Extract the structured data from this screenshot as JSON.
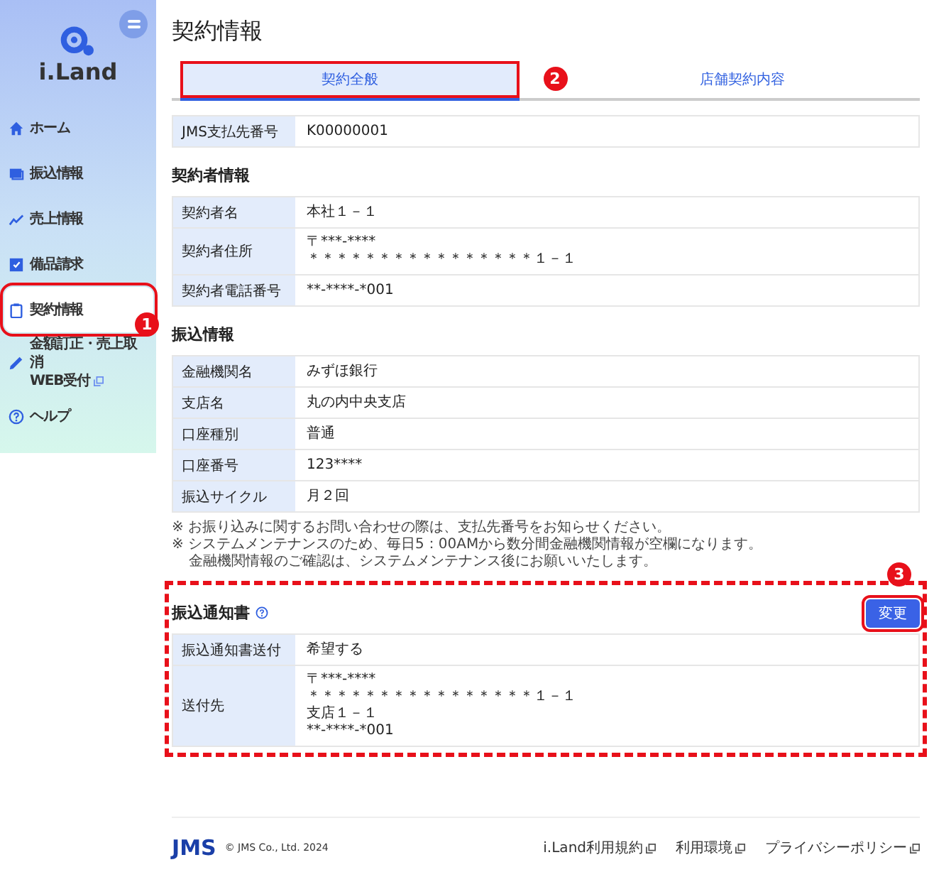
{
  "sidebar": {
    "logo": "i.Land",
    "items": [
      {
        "label": "ホーム",
        "selected": false,
        "highlighted": false
      },
      {
        "label": "振込情報",
        "selected": false,
        "highlighted": false
      },
      {
        "label": "売上情報",
        "selected": false,
        "highlighted": false
      },
      {
        "label": "備品請求",
        "selected": false,
        "highlighted": false
      },
      {
        "label": "契約情報",
        "selected": true,
        "highlighted": true,
        "callout": "1"
      },
      {
        "label": "金額訂正・売上取消",
        "label_2": "WEB受付",
        "external": true,
        "selected": false,
        "highlighted": false
      },
      {
        "label": "ヘルプ",
        "selected": false,
        "highlighted": false
      }
    ]
  },
  "page_title": "契約情報",
  "tabs": [
    {
      "label": "契約全般",
      "selected": true,
      "highlighted": true,
      "callout": "2"
    },
    {
      "label": "店舗契約内容",
      "selected": false,
      "highlighted": false
    }
  ],
  "payee_table": [
    {
      "label": "JMS支払先番号",
      "value_lines": [
        "K00000001"
      ]
    }
  ],
  "sections": [
    {
      "title": "契約者情報",
      "rows": [
        {
          "label": "契約者名",
          "value_lines": [
            "本社１－１"
          ]
        },
        {
          "label": "契約者住所",
          "value_lines": [
            "〒***-****",
            "＊＊＊＊＊＊＊＊＊＊＊＊＊＊＊＊１－１"
          ]
        },
        {
          "label": "契約者電話番号",
          "value_lines": [
            "**-****-*001"
          ]
        }
      ]
    },
    {
      "title": "振込情報",
      "rows": [
        {
          "label": "金融機関名",
          "value_lines": [
            "みずほ銀行"
          ]
        },
        {
          "label": "支店名",
          "value_lines": [
            "丸の内中央支店"
          ]
        },
        {
          "label": "口座種別",
          "value_lines": [
            "普通"
          ]
        },
        {
          "label": "口座番号",
          "value_lines": [
            "123****"
          ]
        },
        {
          "label": "振込サイクル",
          "value_lines": [
            "月２回"
          ]
        }
      ],
      "notes": [
        "※ お振り込みに関するお問い合わせの際は、支払先番号をお知らせください。",
        "※ システムメンテナンスのため、毎日5：00AMから数分間金融機関情報が空欄になります。",
        "金融機関情報のご確認は、システムメンテナンス後にお願いいたします。"
      ]
    }
  ],
  "notice_section": {
    "title": "振込通知書",
    "highlighted": true,
    "button": {
      "label": "変更",
      "highlighted": true,
      "callout": "3"
    },
    "rows": [
      {
        "label": "振込通知書送付",
        "value_lines": [
          "希望する"
        ]
      },
      {
        "label": "送付先",
        "value_lines": [
          "〒***-****",
          "＊＊＊＊＊＊＊＊＊＊＊＊＊＊＊＊１－１",
          "支店１－１",
          "**-****-*001"
        ]
      }
    ]
  },
  "footer": {
    "logo": "JMS",
    "copyright": "© JMS Co., Ltd. 2024",
    "links": [
      "i.Land利用規約",
      "利用環境",
      "プライバシーポリシー"
    ]
  }
}
